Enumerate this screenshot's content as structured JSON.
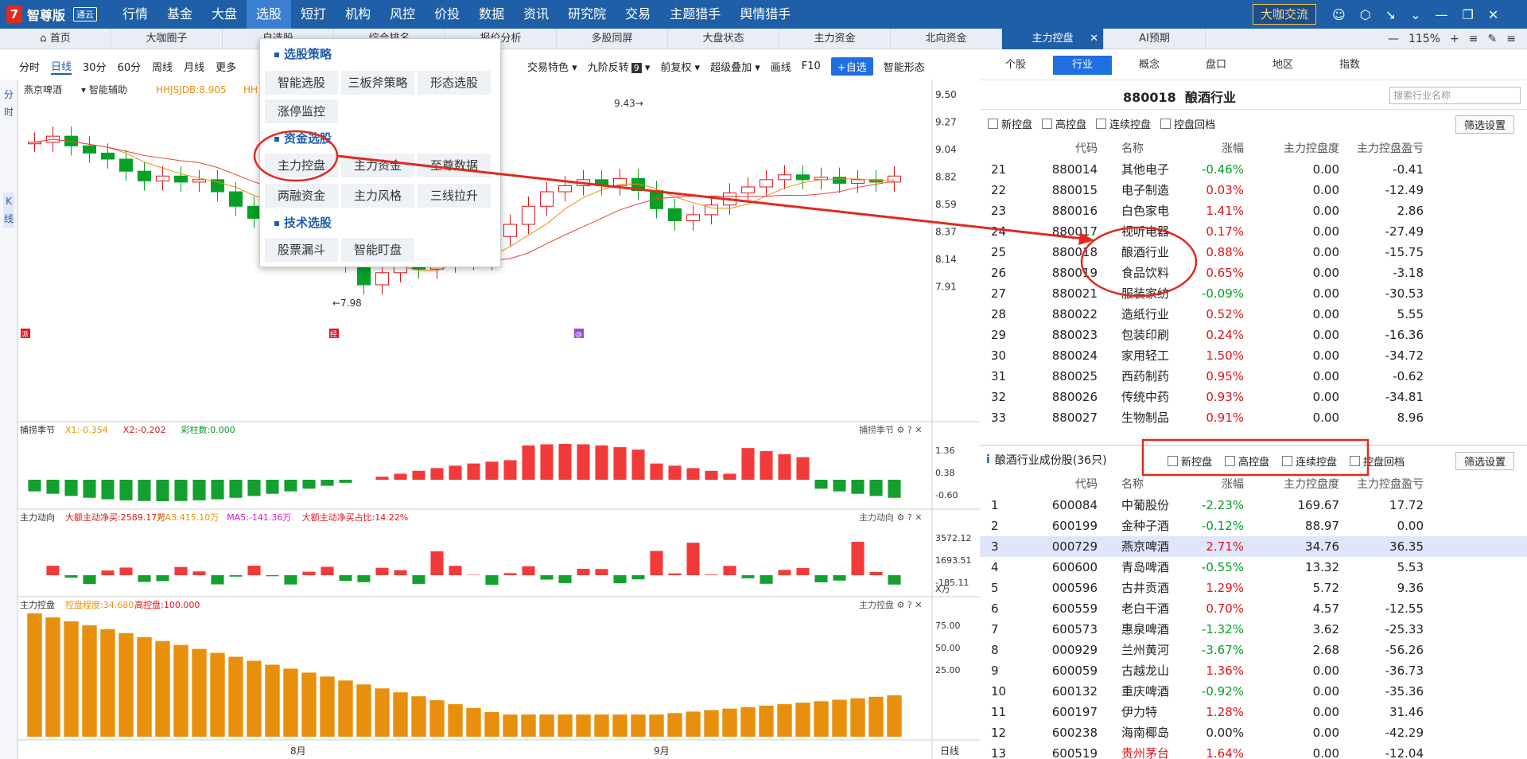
{
  "app": {
    "logo_mark": "7",
    "name": "智尊版",
    "version": "通云",
    "menus": [
      "行情",
      "基金",
      "大盘",
      "选股",
      "短打",
      "机构",
      "风控",
      "价投",
      "数据",
      "资讯",
      "研究院",
      "交易",
      "主题猎手",
      "舆情猎手"
    ],
    "active_menu": "选股",
    "daka": "大咖交流"
  },
  "tabs": [
    "首页",
    "大咖圈子",
    "自选股",
    "综合排名",
    "报价分析",
    "多股同屏",
    "大盘状态",
    "主力资金",
    "北向资金",
    "主力控盘",
    "AI预期"
  ],
  "active_tab": "主力控盘",
  "zoom": "115%",
  "chart_toolbar": {
    "periods": [
      "分时",
      "日线",
      "30分",
      "60分",
      "周线",
      "月线",
      "更多"
    ],
    "active_period": "日线",
    "right": [
      "交易特色",
      "九阶反转",
      "前复权",
      "超级叠加",
      "画线",
      "F10"
    ],
    "nine_badge": "9",
    "add_btn": "+自选",
    "smart": "智能形态"
  },
  "left_strip": {
    "top": "分时",
    "bottom": "K线"
  },
  "stock": {
    "name": "燕京啤酒",
    "assist": "智能辅助",
    "indicator": "HHJSJDB:8.905",
    "ind2": "HH",
    "high_label": "9.43",
    "low_label": "7.98",
    "marks": [
      "派",
      "经",
      "@"
    ]
  },
  "price_axis": [
    "9.50",
    "9.27",
    "9.04",
    "8.82",
    "8.59",
    "8.37",
    "8.14",
    "7.91"
  ],
  "x_axis": {
    "labels": [
      "8月",
      "9月"
    ],
    "period": "日线"
  },
  "panels": [
    {
      "name": "捕捞季节",
      "items": [
        {
          "t": "X1:-0.354",
          "c": "#e8900e"
        },
        {
          "t": "X2:-0.202",
          "c": "#e0151b"
        },
        {
          "t": "彩柱数:0.000",
          "c": "#06a026"
        }
      ],
      "axis": [
        "1.36",
        "0.38",
        "-0.60"
      ]
    },
    {
      "name": "主力动向",
      "items": [
        {
          "t": "大额主动净买:2589.17万",
          "c": "#e0151b"
        },
        {
          "t": "MA3:415.10万",
          "c": "#e8900e"
        },
        {
          "t": "MA5:-141.36万",
          "c": "#d418d4"
        },
        {
          "t": "大额主动净买占比:14.22%",
          "c": "#e0151b"
        }
      ],
      "axis": [
        "3572.12",
        "1693.51",
        "-185.11"
      ],
      "unit": "X万"
    },
    {
      "name": "主力控盘",
      "items": [
        {
          "t": "控盘程度:34.680",
          "c": "#e8900e"
        },
        {
          "t": "高控盘:100.000",
          "c": "#e0151b"
        }
      ],
      "axis": [
        "75.00",
        "50.00",
        "25.00"
      ]
    }
  ],
  "popup": {
    "s1": "选股策略",
    "s1_items": [
      "智能选股",
      "三板斧策略",
      "形态选股",
      "涨停监控"
    ],
    "s2": "资金选股",
    "s2_items": [
      "主力控盘",
      "主力资金",
      "至尊数据",
      "两融资金",
      "主力风格",
      "三线拉升"
    ],
    "s3": "技术选股",
    "s3_items": [
      "股票漏斗",
      "智能盯盘"
    ]
  },
  "right_tabs": [
    "个股",
    "行业",
    "概念",
    "盘口",
    "地区",
    "指数"
  ],
  "right_active": "行业",
  "industry": {
    "code": "880018",
    "name": "酿酒行业",
    "search_placeholder": "搜索行业名称"
  },
  "filters": [
    "新控盘",
    "高控盘",
    "连续控盘",
    "控盘回档"
  ],
  "filter_btn": "筛选设置",
  "columns": [
    "代码",
    "名称",
    "涨幅",
    "主力控盘度",
    "主力控盘盈亏"
  ],
  "industries": [
    [
      "21",
      "880014",
      "其他电子",
      "-0.46%",
      "0.00",
      "-0.41"
    ],
    [
      "22",
      "880015",
      "电子制造",
      "0.03%",
      "0.00",
      "-12.49"
    ],
    [
      "23",
      "880016",
      "白色家电",
      "1.41%",
      "0.00",
      "2.86"
    ],
    [
      "24",
      "880017",
      "视听电器",
      "0.17%",
      "0.00",
      "-27.49"
    ],
    [
      "25",
      "880018",
      "酿酒行业",
      "0.88%",
      "0.00",
      "-15.75"
    ],
    [
      "26",
      "880019",
      "食品饮料",
      "0.65%",
      "0.00",
      "-3.18"
    ],
    [
      "27",
      "880021",
      "服装家纺",
      "-0.09%",
      "0.00",
      "-30.53"
    ],
    [
      "28",
      "880022",
      "造纸行业",
      "0.52%",
      "0.00",
      "5.55"
    ],
    [
      "29",
      "880023",
      "包装印刷",
      "0.24%",
      "0.00",
      "-16.36"
    ],
    [
      "30",
      "880024",
      "家用轻工",
      "1.50%",
      "0.00",
      "-34.72"
    ],
    [
      "31",
      "880025",
      "西药制药",
      "0.95%",
      "0.00",
      "-0.62"
    ],
    [
      "32",
      "880026",
      "传统中药",
      "0.93%",
      "0.00",
      "-34.81"
    ],
    [
      "33",
      "880027",
      "生物制品",
      "0.91%",
      "0.00",
      "8.96"
    ]
  ],
  "constituents_title": "酿酒行业成份股(36只)",
  "stocks": [
    [
      "1",
      "600084",
      "中葡股份",
      "-2.23%",
      "169.67",
      "17.72"
    ],
    [
      "2",
      "600199",
      "金种子酒",
      "-0.12%",
      "88.97",
      "0.00"
    ],
    [
      "3",
      "000729",
      "燕京啤酒",
      "2.71%",
      "34.76",
      "36.35"
    ],
    [
      "4",
      "600600",
      "青岛啤酒",
      "-0.55%",
      "13.32",
      "5.53"
    ],
    [
      "5",
      "000596",
      "古井贡酒",
      "1.29%",
      "5.72",
      "9.36"
    ],
    [
      "6",
      "600559",
      "老白干酒",
      "0.70%",
      "4.57",
      "-12.55"
    ],
    [
      "7",
      "600573",
      "惠泉啤酒",
      "-1.32%",
      "3.62",
      "-25.33"
    ],
    [
      "8",
      "000929",
      "兰州黄河",
      "-3.67%",
      "2.68",
      "-56.26"
    ],
    [
      "9",
      "600059",
      "古越龙山",
      "1.36%",
      "0.00",
      "-36.73"
    ],
    [
      "10",
      "600132",
      "重庆啤酒",
      "-0.92%",
      "0.00",
      "-35.36"
    ],
    [
      "11",
      "600197",
      "伊力特",
      "1.28%",
      "0.00",
      "31.46"
    ],
    [
      "12",
      "600238",
      "海南椰岛",
      "0.00%",
      "0.00",
      "-42.29"
    ],
    [
      "13",
      "600519",
      "贵州茅台",
      "1.64%",
      "0.00",
      "-12.04"
    ]
  ],
  "selected_stock_row": "3",
  "colors": {
    "nav": "#1f5fa8",
    "up": "#e0151b",
    "down": "#06a026",
    "annotation": "#e02a1f"
  }
}
